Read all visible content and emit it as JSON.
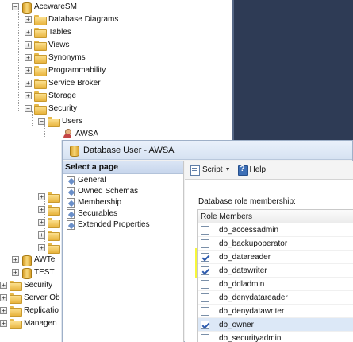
{
  "tree": {
    "items": [
      {
        "label": "AcewareSM",
        "icon": "database-icon",
        "expander": "−"
      },
      {
        "label": "Database Diagrams",
        "icon": "folder-icon",
        "expander": "+"
      },
      {
        "label": "Tables",
        "icon": "folder-icon",
        "expander": "+"
      },
      {
        "label": "Views",
        "icon": "folder-icon",
        "expander": "+"
      },
      {
        "label": "Synonyms",
        "icon": "folder-icon",
        "expander": "+"
      },
      {
        "label": "Programmability",
        "icon": "folder-icon",
        "expander": "+"
      },
      {
        "label": "Service Broker",
        "icon": "folder-icon",
        "expander": "+"
      },
      {
        "label": "Storage",
        "icon": "folder-icon",
        "expander": "+"
      },
      {
        "label": "Security",
        "icon": "folder-icon",
        "expander": "−"
      },
      {
        "label": "Users",
        "icon": "folder-icon",
        "expander": "−"
      },
      {
        "label": "AWSA",
        "icon": "user-icon",
        "expander": ""
      }
    ],
    "lower_items": [
      {
        "label": "AWTe",
        "icon": "database-icon",
        "expander": "+"
      },
      {
        "label": "TEST",
        "icon": "database-icon",
        "expander": "+"
      },
      {
        "label": "Security",
        "icon": "folder-icon",
        "expander": "+"
      },
      {
        "label": "Server Ob",
        "icon": "folder-icon",
        "expander": "+"
      },
      {
        "label": "Replicatio",
        "icon": "folder-icon",
        "expander": "+"
      },
      {
        "label": "Managen",
        "icon": "folder-icon",
        "expander": "+"
      }
    ]
  },
  "dialog": {
    "title": "Database User - AWSA",
    "select_page": "Select a page",
    "pages": [
      "General",
      "Owned Schemas",
      "Membership",
      "Securables",
      "Extended Properties"
    ],
    "toolbar": {
      "script_label": "Script",
      "help_label": "Help"
    },
    "section_label": "Database role membership:",
    "grid_header": "Role Members",
    "roles": [
      {
        "name": "db_accessadmin",
        "checked": false
      },
      {
        "name": "db_backupoperator",
        "checked": false
      },
      {
        "name": "db_datareader",
        "checked": true
      },
      {
        "name": "db_datawriter",
        "checked": true
      },
      {
        "name": "db_ddladmin",
        "checked": false
      },
      {
        "name": "db_denydatareader",
        "checked": false
      },
      {
        "name": "db_denydatawriter",
        "checked": false
      },
      {
        "name": "db_owner",
        "checked": true
      },
      {
        "name": "db_securityadmin",
        "checked": false
      }
    ],
    "highlight_color": "#f6f73a",
    "selected_row_color": "#dce8f7"
  }
}
